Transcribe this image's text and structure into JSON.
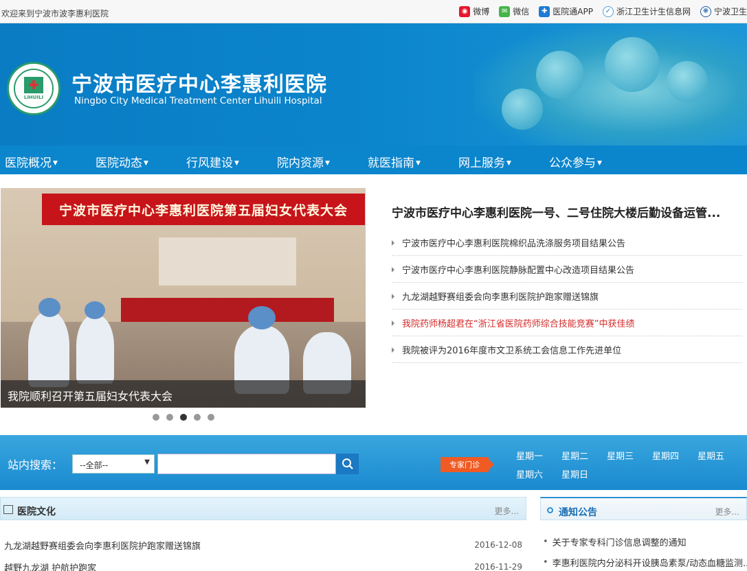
{
  "topbar": {
    "welcome": "欢迎来到宁波市波李惠利医院",
    "links": [
      {
        "label": "微博",
        "icon": "weibo-icon"
      },
      {
        "label": "微信",
        "icon": "weixin-icon"
      },
      {
        "label": "医院通APP",
        "icon": "app-icon"
      },
      {
        "label": "浙江卫生计生信息网",
        "icon": "health-network-icon"
      },
      {
        "label": "宁波卫生",
        "icon": "ningbo-health-icon"
      }
    ]
  },
  "header": {
    "title": "宁波市医疗中心李惠利医院",
    "subtitle": "Ningbo City Medical Treatment Center Lihuili Hospital",
    "logo_text": "LIHUILI"
  },
  "nav": {
    "items": [
      "医院概况",
      "医院动态",
      "行风建设",
      "院内资源",
      "就医指南",
      "网上服务",
      "公众参与"
    ]
  },
  "slider": {
    "banner_text": "宁波市医疗中心李惠利医院第五届妇女代表大会",
    "caption": "我院顺利召开第五届妇女代表大会",
    "slide_count": 5,
    "active_index": 2
  },
  "news": {
    "headline": "宁波市医疗中心李惠利医院一号、二号住院大楼后勤设备运管...",
    "items": [
      {
        "text": "宁波市医疗中心李惠利医院棉织品洗涤服务项目结果公告",
        "highlight": false
      },
      {
        "text": "宁波市医疗中心李惠利医院静脉配置中心改造项目结果公告",
        "highlight": false
      },
      {
        "text": "九龙湖越野赛组委会向李惠利医院护跑家赠送锦旗",
        "highlight": false
      },
      {
        "text": "我院药师杨超君在“浙江省医院药师综合技能竞赛”中获佳绩",
        "highlight": true
      },
      {
        "text": "我院被评为2016年度市文卫系统工会信息工作先进单位",
        "highlight": false
      }
    ]
  },
  "search": {
    "label": "站内搜索：",
    "select_value": "--全部--",
    "input_value": "",
    "expert_label": "专家门诊",
    "weekdays": [
      "星期一",
      "星期二",
      "星期三",
      "星期四",
      "星期五",
      "星期六",
      "星期日"
    ]
  },
  "culture": {
    "title": "医院文化",
    "more": "更多...",
    "items": [
      {
        "text": "九龙湖越野赛组委会向李惠利医院护跑家赠送锦旗",
        "date": "2016-12-08"
      },
      {
        "text": "越野九龙湖 护航护跑家",
        "date": "2016-11-29"
      }
    ]
  },
  "notice": {
    "title": "通知公告",
    "more": "更多...",
    "items": [
      "关于专家专科门诊信息调整的通知",
      "李惠利医院内分泌科开设胰岛素泵/动态血糖监测..."
    ]
  },
  "colors": {
    "brand_blue": "#0b85cc",
    "accent_orange": "#f05a23",
    "highlight_red": "#d42a2a"
  }
}
